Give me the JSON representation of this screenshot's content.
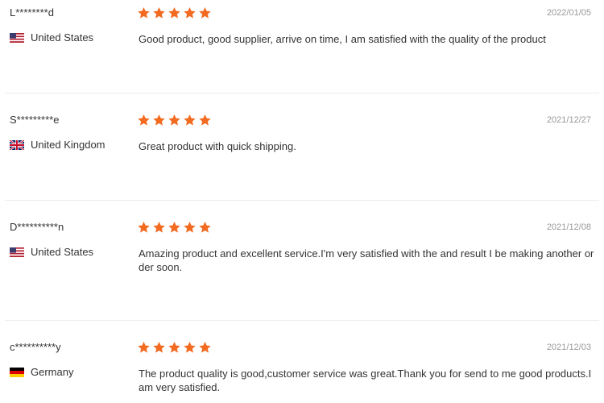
{
  "colors": {
    "star": "#f26b21",
    "divider": "#ededed",
    "date": "#999999"
  },
  "reviews": [
    {
      "user": "L********d",
      "country": "United States",
      "flag": "us-flag-icon",
      "rating": 5,
      "date": "2022/01/05",
      "text": "Good product, good supplier, arrive on time, I am satisfied with the quality of the product"
    },
    {
      "user": "S*********e",
      "country": "United Kingdom",
      "flag": "uk-flag-icon",
      "rating": 5,
      "date": "2021/12/27",
      "text": "Great product with quick shipping."
    },
    {
      "user": "D**********n",
      "country": "United States",
      "flag": "us-flag-icon",
      "rating": 5,
      "date": "2021/12/08",
      "text": "Amazing product and excellent service.I'm very satisfied with the and result I be making another order soon."
    },
    {
      "user": "c**********y",
      "country": "Germany",
      "flag": "germany-flag-icon",
      "rating": 5,
      "date": "2021/12/03",
      "text": "The product quality is good,customer service was great.Thank you for send to me good products.I am very satisfied."
    }
  ]
}
